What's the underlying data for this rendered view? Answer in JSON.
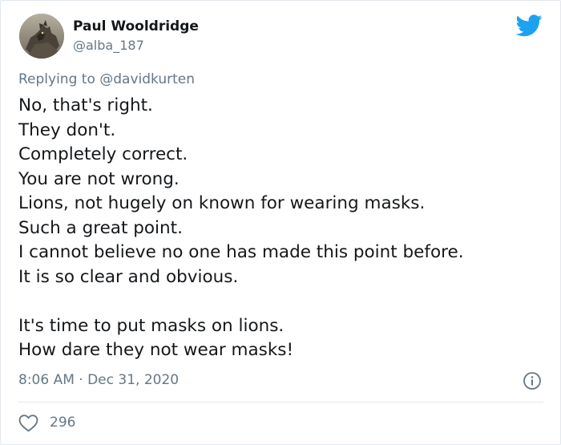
{
  "tweet": {
    "author": {
      "name": "Paul Wooldridge",
      "handle": "@alba_187",
      "avatar_icon": "wolf-avatar"
    },
    "reply": {
      "prefix": "Replying to",
      "mention": "@davidkurten"
    },
    "lines": [
      "No, that's right.",
      "They don't.",
      "Completely correct.",
      "You are not wrong.",
      "Lions, not hugely on known for wearing masks.",
      "Such a great point.",
      "I cannot believe no one has made this point before.",
      "It is so clear and obvious.",
      "",
      "It's time to put masks on lions.",
      "How dare they not wear masks!"
    ],
    "timestamp": "8:06 AM · Dec 31, 2020",
    "likes": "296"
  },
  "colors": {
    "twitter_blue": "#1da1f2",
    "muted_text": "#657786",
    "body_text": "#14171a",
    "border": "#e1e8ed"
  },
  "icons": {
    "brand": "twitter-bird-icon",
    "info": "info-icon",
    "like": "heart-icon"
  }
}
